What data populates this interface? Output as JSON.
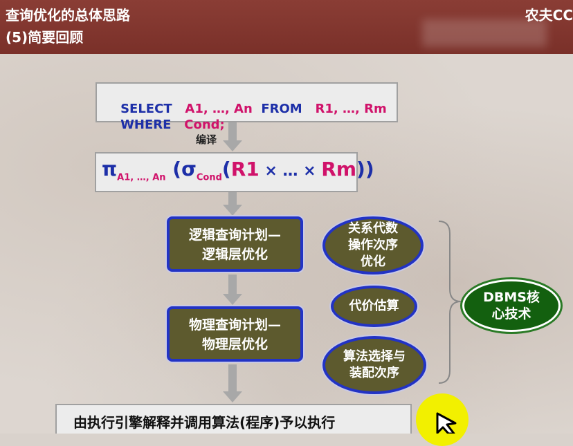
{
  "header": {
    "title": "查询优化的总体思路",
    "subtitle": "(5)简要回顾",
    "brand": "农夫CC"
  },
  "sql": {
    "line1": [
      {
        "text": "SELECT",
        "color": "#1d2fa8"
      },
      {
        "text": "   A1, …, An",
        "color": "#d0126a"
      },
      {
        "text": "  FROM",
        "color": "#1d2fa8"
      },
      {
        "text": "   R1, …, Rm",
        "color": "#d0126a"
      }
    ],
    "line2": [
      {
        "text": "WHERE",
        "color": "#1d2fa8"
      },
      {
        "text": "   Cond;",
        "color": "#d0126a"
      }
    ]
  },
  "compile_label": "编译",
  "algebra": {
    "pi": "π",
    "pi_sub": "A1, …, An",
    "open": " (",
    "sigma": "σ",
    "sigma_sub": "Cond",
    "paren": "(",
    "r1": "R1",
    "times1": " × … × ",
    "rm": "Rm",
    "close": "))"
  },
  "logical_plan": [
    "逻辑查询计划—",
    "逻辑层优化"
  ],
  "physical_plan": [
    "物理查询计划—",
    "物理层优化"
  ],
  "oval_algebra": [
    "关系代数",
    "操作次序",
    "优化"
  ],
  "oval_cost": [
    "代价估算"
  ],
  "oval_algorithm": [
    "算法选择与",
    "装配次序"
  ],
  "dbms_core": [
    "DBMS核",
    "心技术"
  ],
  "execute_text": "由执行引擎解释并调用算法(程序)予以执行"
}
